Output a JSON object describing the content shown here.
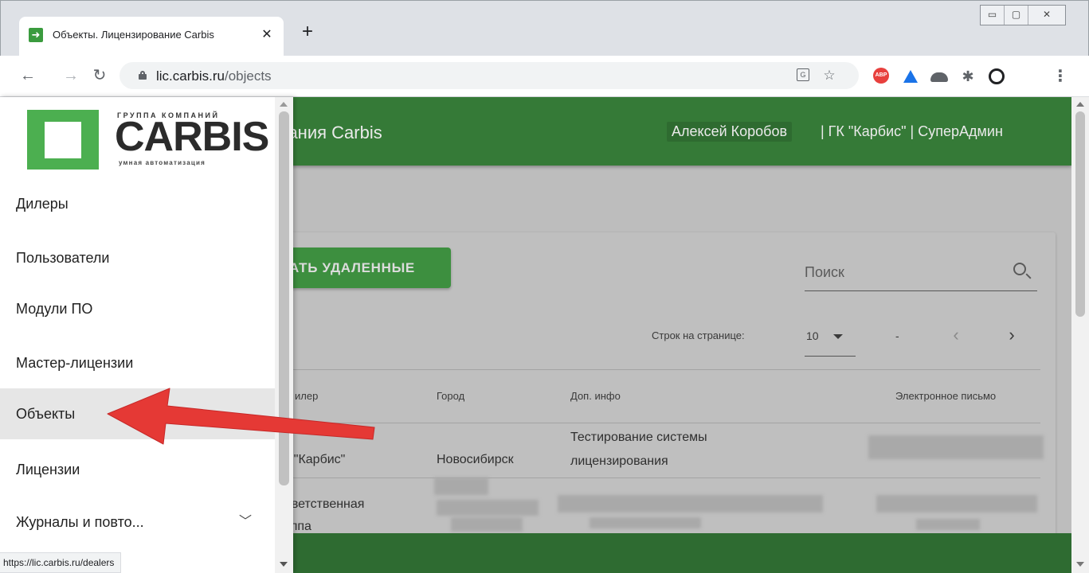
{
  "browser": {
    "tab_title": "Объекты. Лицензирование Carbis",
    "tab_favicon": "green-arrow-icon",
    "new_tab_label": "+",
    "tab_close": "✕",
    "url_host": "lic.carbis.ru",
    "url_path": "/objects",
    "status_url": "https://lic.carbis.ru/dealers",
    "extension_abp_label": "ABP"
  },
  "appbar": {
    "title": "вания Carbis",
    "user_name": "Алексей Коробов",
    "user_rest": "| ГК \"Карбис\" | СуперАдмин"
  },
  "drawer": {
    "logo": {
      "group": "ГРУППА КОМПАНИЙ",
      "word": "CARBIS",
      "tagline": "умная автоматизация"
    },
    "items": [
      {
        "label": "Дилеры"
      },
      {
        "label": "Пользователи"
      },
      {
        "label": "Модули ПО"
      },
      {
        "label": "Мастер-лицензии"
      },
      {
        "label": "Объекты"
      },
      {
        "label": "Лицензии"
      },
      {
        "label": "Журналы и повто..."
      }
    ]
  },
  "toolbar": {
    "show_deleted_label": "АТЬ УДАЛЕННЫЕ",
    "search_placeholder": "Поиск"
  },
  "pagination": {
    "rows_label": "Строк на странице:",
    "rows_value": "10",
    "range_text": "-"
  },
  "table": {
    "headers": [
      "илер",
      "Город",
      "Доп. инфо",
      "Электронное письмо"
    ],
    "rows": [
      {
        "dealer": "К \"Карбис\"",
        "city": "Новосибирск",
        "info_line1": "Тестирование системы",
        "info_line2": "лицензирования"
      },
      {
        "dealer_line1": "риветственная",
        "dealer_line2": "руппа"
      }
    ]
  },
  "colors": {
    "brand_green": "#4caf50",
    "active_item_bg": "#e6e6e6",
    "annotation_arrow": "#e53935"
  }
}
